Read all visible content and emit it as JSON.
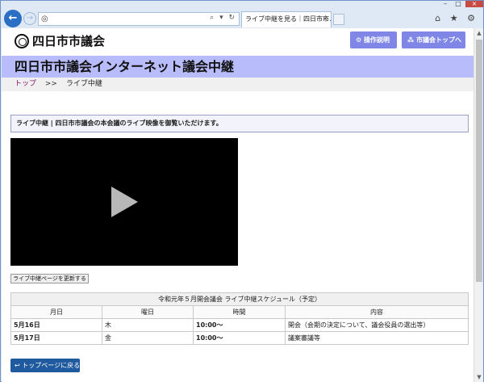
{
  "browser": {
    "address_icon": "site-icon",
    "address_tools": "⌕ ▾ ↻",
    "tab_title": "ライブ中継を見る｜四日市市...",
    "tab_close": "×",
    "window_min": "–",
    "window_max": "□",
    "window_close": "×",
    "right_icons": "⌂ ★ ⚙"
  },
  "header": {
    "logo_text": "四日市市議会",
    "help_button": "操作説明",
    "top_button": "市議会トップへ"
  },
  "page_title": "四日市市議会インターネット議会中継",
  "breadcrumb": {
    "home": "トップ",
    "separator": ">>",
    "current": "ライブ中継"
  },
  "notice": "ライブ中継 | 四日市市議会の本会議のライブ映像を御覧いただけます。",
  "refresh_button": "ライブ中継ページを更新する",
  "schedule": {
    "caption": "令和元年５月開会議会 ライブ中継スケジュール（予定）",
    "headers": [
      "月日",
      "曜日",
      "時間",
      "内容"
    ],
    "rows": [
      [
        "5月16日",
        "木",
        "10:00～",
        "開会（会期の決定について、議会役員の選出等）"
      ],
      [
        "5月17日",
        "金",
        "10:00～",
        "議案審議等"
      ]
    ]
  },
  "back_button": "トップページに戻る",
  "colors": {
    "title_band": "#b8bcfb",
    "header_button": "#7f86e6",
    "back_button": "#1f5a9e",
    "breadcrumb_link": "#8b1a6b"
  }
}
